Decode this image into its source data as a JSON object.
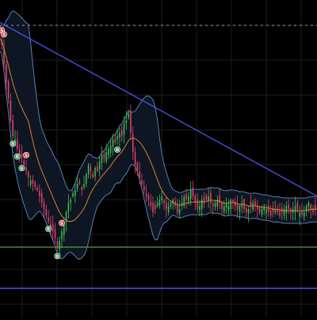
{
  "chart_data": {
    "type": "candlestick",
    "title": "",
    "xlabel": "",
    "ylabel": "",
    "ylim": [
      0,
      100
    ],
    "grid": true,
    "legend": "none",
    "colors": {
      "background": "#000000",
      "grid": "#1e1e1e",
      "candle_up": "#3fbf52",
      "candle_down": "#e8446b",
      "bollinger_band": "#5a7fae",
      "bollinger_fill": "#0d1622",
      "moving_average": "#d9802e",
      "trendline": "#4c54e8",
      "support_line": "#5c9c38",
      "level_line": "#4c54e8",
      "dashed_level": "#9a9a9a",
      "buy_marker": "#1f8a3b",
      "sell_marker": "#cc4040"
    },
    "candles_from_close": [
      88,
      86,
      80,
      74,
      69,
      62,
      57,
      56,
      53,
      51,
      50,
      48,
      46,
      44,
      43,
      42,
      41,
      40,
      38,
      36,
      34,
      32,
      30,
      28,
      27,
      25,
      22,
      24,
      27,
      30,
      33,
      36,
      37,
      39,
      40,
      42,
      42,
      40,
      42,
      45,
      48,
      46,
      44,
      47,
      46,
      49,
      51,
      50,
      52,
      53,
      54,
      56,
      55,
      57,
      58,
      57,
      61,
      62,
      64,
      58,
      52,
      48,
      46,
      44,
      42,
      40,
      38,
      37,
      35,
      33,
      34,
      36,
      37,
      38,
      36,
      34,
      35,
      36,
      37,
      35,
      33,
      34,
      36,
      38,
      37,
      38,
      40,
      38,
      36,
      34,
      35,
      37,
      36,
      37,
      38,
      36,
      35,
      36,
      37,
      36,
      34,
      35,
      36,
      35,
      37,
      36,
      35,
      34,
      35,
      36,
      34,
      33,
      34,
      35,
      36,
      35,
      34,
      33,
      34,
      35,
      34,
      33,
      32,
      33,
      34,
      33,
      32,
      33,
      34,
      35,
      34,
      33,
      34,
      35,
      34,
      33,
      32,
      33,
      35,
      36,
      34,
      33,
      34,
      35
    ],
    "trendline": [
      {
        "x": 0,
        "y": 93
      },
      {
        "x": 143,
        "y": 38
      }
    ],
    "support_level": 22,
    "lower_level": 9,
    "dashed_level": 92,
    "markers": [
      {
        "x": 1,
        "type": "sell",
        "label": "S"
      },
      {
        "x": 2,
        "type": "sell",
        "label": "S"
      },
      {
        "x": 12,
        "type": "sell",
        "label": "S"
      },
      {
        "x": 6,
        "type": "buy",
        "label": "B"
      },
      {
        "x": 8,
        "type": "buy",
        "label": "B"
      },
      {
        "x": 10,
        "type": "buy",
        "label": "B"
      },
      {
        "x": 22,
        "type": "buy",
        "label": "B"
      },
      {
        "x": 26,
        "type": "buy",
        "label": "B"
      },
      {
        "x": 28,
        "type": "sell",
        "label": "S"
      },
      {
        "x": 53,
        "type": "buy",
        "label": "B"
      }
    ]
  }
}
